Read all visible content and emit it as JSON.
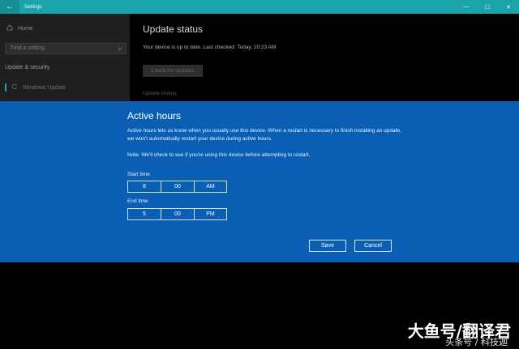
{
  "window": {
    "title": "Settings",
    "back_icon": "←",
    "minimize": "—",
    "maximize": "☐",
    "close": "✕"
  },
  "sidebar": {
    "home_label": "Home",
    "search_placeholder": "Find a setting",
    "section_title": "Update & security",
    "active_item": "Windows Update"
  },
  "main": {
    "title": "Update status",
    "status_text": "Your device is up to date. Last checked: Today, 10:23 AM",
    "check_button": "Check for updates",
    "history_link": "Update history"
  },
  "dialog": {
    "title": "Active hours",
    "description": "Active hours lets us know when you usually use this device. When a restart is necessary to finish installing an update, we won't automatically restart your device during active hours.",
    "note": "Note: We'll check to see if you're using this device before attempting to restart.",
    "start_label": "Start time",
    "start": {
      "hour": "8",
      "minute": "00",
      "period": "AM"
    },
    "end_label": "End time",
    "end": {
      "hour": "5",
      "minute": "00",
      "period": "PM"
    },
    "save_button": "Save",
    "cancel_button": "Cancel"
  },
  "watermark": {
    "main": "大鱼号/翻译君",
    "sub": "头条号 / 科技迦"
  },
  "colors": {
    "titlebar": "#1aa3a8",
    "dialog": "#0a5fb4",
    "sidebar": "#1f1f1f"
  }
}
